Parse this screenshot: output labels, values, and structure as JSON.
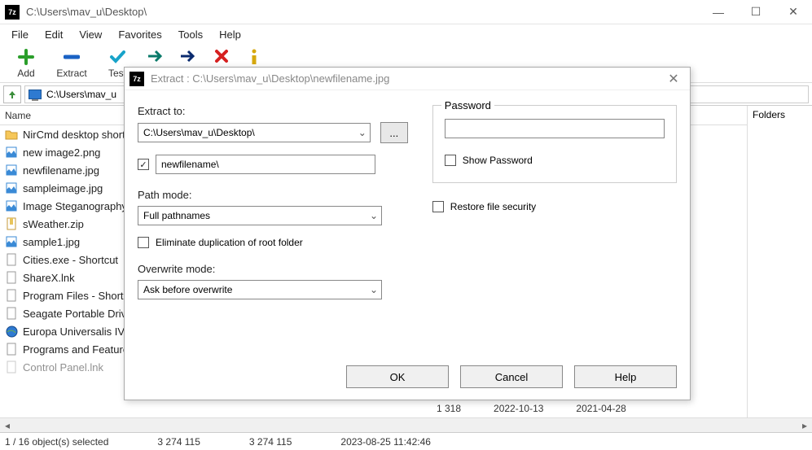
{
  "window": {
    "app_icon_text": "7z",
    "title": "C:\\Users\\mav_u\\Desktop\\"
  },
  "menu": [
    "File",
    "Edit",
    "View",
    "Favorites",
    "Tools",
    "Help"
  ],
  "toolbar": {
    "add": "Add",
    "extract": "Extract",
    "test": "Test"
  },
  "pathbar": {
    "path": "C:\\Users\\mav_u"
  },
  "columns": {
    "name": "Name"
  },
  "folders_label": "Folders",
  "files": [
    {
      "icon": "folder",
      "name": "NirCmd desktop shortcuts"
    },
    {
      "icon": "image",
      "name": "new image2.png"
    },
    {
      "icon": "image",
      "name": "newfilename.jpg"
    },
    {
      "icon": "image",
      "name": "sampleimage.jpg"
    },
    {
      "icon": "image",
      "name": "Image Steganography"
    },
    {
      "icon": "zip",
      "name": "sWeather.zip"
    },
    {
      "icon": "image",
      "name": "sample1.jpg"
    },
    {
      "icon": "file",
      "name": "Cities.exe - Shortcut"
    },
    {
      "icon": "file",
      "name": "ShareX.lnk"
    },
    {
      "icon": "file",
      "name": "Program Files - Shortcut"
    },
    {
      "icon": "file",
      "name": "Seagate Portable Drive"
    },
    {
      "icon": "globe",
      "name": "Europa Universalis IV"
    },
    {
      "icon": "file",
      "name": "Programs and Features"
    },
    {
      "icon": "file",
      "name": "Control Panel.lnk"
    }
  ],
  "cutoff_row": {
    "size": "1 318",
    "date1": "2022-10-13",
    "date2": "2021-04-28"
  },
  "status": {
    "selected": "1 / 16 object(s) selected",
    "size1": "3 274 115",
    "size2": "3 274 115",
    "date": "2023-08-25 11:42:46"
  },
  "dialog": {
    "title": "Extract : C:\\Users\\mav_u\\Desktop\\newfilename.jpg",
    "extract_to_label": "Extract to:",
    "extract_to_value": "C:\\Users\\mav_u\\Desktop\\",
    "subfolder_value": "newfilename\\",
    "browse": "...",
    "path_mode_label": "Path mode:",
    "path_mode_value": "Full pathnames",
    "eliminate_label": "Eliminate duplication of root folder",
    "overwrite_label": "Overwrite mode:",
    "overwrite_value": "Ask before overwrite",
    "password_label": "Password",
    "show_password_label": "Show Password",
    "restore_label": "Restore file security",
    "ok": "OK",
    "cancel": "Cancel",
    "help": "Help"
  }
}
